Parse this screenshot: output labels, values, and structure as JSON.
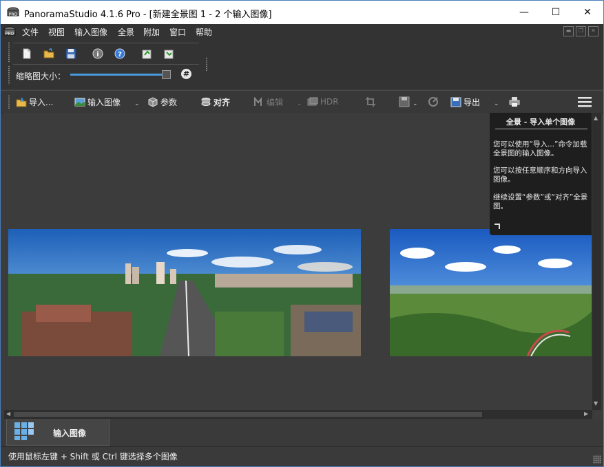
{
  "window": {
    "title": "PanoramaStudio 4.1.6 Pro - [新建全景图 1 - 2 个输入图像]",
    "minimize_glyph": "—",
    "maximize_glyph": "☐",
    "close_glyph": "✕"
  },
  "menu": {
    "items": [
      "文件",
      "视图",
      "输入图像",
      "全景",
      "附加",
      "窗口",
      "帮助"
    ]
  },
  "thumbnail_size": {
    "label": "缩略图大小：",
    "value": 0.99,
    "grid_button": "#"
  },
  "toolbar": {
    "import": "导入...",
    "input_images": "输入图像",
    "params": "参数",
    "align": "对齐",
    "edit": "编辑",
    "hdr": "HDR",
    "export": "导出"
  },
  "info_panel": {
    "heading": "全景 - 导入单个图像",
    "para1": "您可以使用“导入...”命令加载全景图的输入图像。",
    "para2": "您可以按任意顺序和方向导入图像。",
    "para3": "继续设置“参数”或“对齐”全景图。"
  },
  "bottom_tab": {
    "label": "输入图像"
  },
  "status": {
    "text": "使用鼠标左键 + Shift 或 Ctrl 键选择多个图像"
  },
  "colors": {
    "accent": "#4a9ae0",
    "window_bg": "#3c3c3c",
    "panel_bg": "#1e1e1e"
  }
}
